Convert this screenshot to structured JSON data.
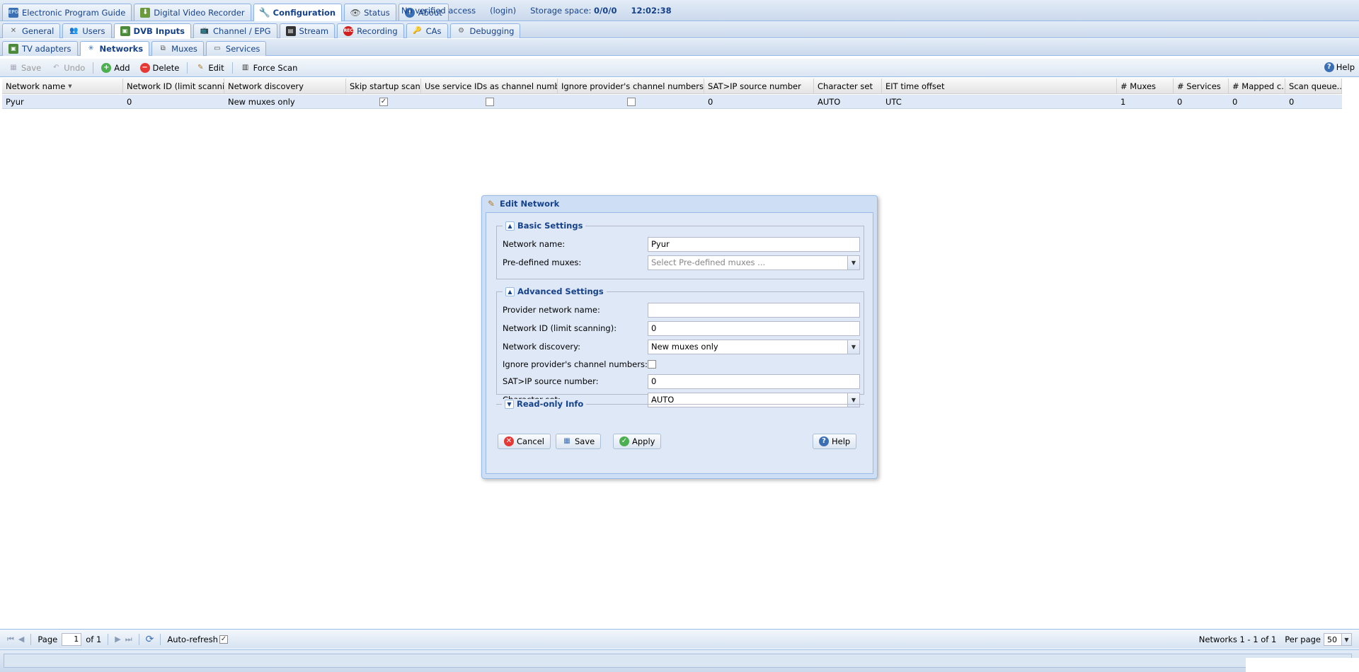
{
  "topbar": {
    "tabs": [
      {
        "label": "Electronic Program Guide",
        "icon": "epg-icon",
        "active": false
      },
      {
        "label": "Digital Video Recorder",
        "icon": "download-icon",
        "active": false
      },
      {
        "label": "Configuration",
        "icon": "wrench-icon",
        "active": true
      },
      {
        "label": "Status",
        "icon": "eye-icon",
        "active": false
      },
      {
        "label": "About",
        "icon": "info-icon",
        "active": false
      }
    ],
    "access": "No verified access",
    "login": "(login)",
    "storage_label": "Storage space:",
    "storage_value": "0/0/0",
    "time": "12:02:38"
  },
  "config_tabs": [
    {
      "label": "General",
      "icon": "tools-icon",
      "active": false
    },
    {
      "label": "Users",
      "icon": "users-icon",
      "active": false
    },
    {
      "label": "DVB Inputs",
      "icon": "tv-card-icon",
      "active": true
    },
    {
      "label": "Channel / EPG",
      "icon": "tv-icon",
      "active": false
    },
    {
      "label": "Stream",
      "icon": "film-icon",
      "active": false
    },
    {
      "label": "Recording",
      "icon": "rec-icon",
      "active": false
    },
    {
      "label": "CAs",
      "icon": "key-icon",
      "active": false
    },
    {
      "label": "Debugging",
      "icon": "bug-icon",
      "active": false
    }
  ],
  "dvb_tabs": [
    {
      "label": "TV adapters",
      "icon": "adapter-icon",
      "active": false
    },
    {
      "label": "Networks",
      "icon": "antenna-icon",
      "active": true
    },
    {
      "label": "Muxes",
      "icon": "muxes-icon",
      "active": false
    },
    {
      "label": "Services",
      "icon": "services-icon",
      "active": false
    }
  ],
  "toolbar": {
    "save": "Save",
    "undo": "Undo",
    "add": "Add",
    "delete": "Delete",
    "edit": "Edit",
    "force_scan": "Force Scan",
    "help": "Help"
  },
  "grid": {
    "columns": [
      "Network name",
      "Network ID (limit scanning)",
      "Network discovery",
      "Skip startup scan",
      "Use service IDs as channel numbers",
      "Ignore provider's channel numbers",
      "SAT>IP source number",
      "Character set",
      "EIT time offset",
      "# Muxes",
      "# Services",
      "# Mapped c...",
      "Scan queue..."
    ],
    "rows": [
      {
        "network_name": "Pyur",
        "network_id": "0",
        "discovery": "New muxes only",
        "skip_startup_scan": true,
        "use_service_ids": false,
        "ignore_provider": false,
        "satip_source": "0",
        "charset": "AUTO",
        "eit_offset": "UTC",
        "muxes": "1",
        "services": "0",
        "mapped": "0",
        "scan_queue": "0"
      }
    ]
  },
  "dialog": {
    "title": "Edit Network",
    "basic_legend": "Basic Settings",
    "network_name_label": "Network name:",
    "network_name_value": "Pyur",
    "predefined_label": "Pre-defined muxes:",
    "predefined_placeholder": "Select Pre-defined muxes ...",
    "advanced_legend": "Advanced Settings",
    "provider_label": "Provider network name:",
    "provider_value": "",
    "netid_label": "Network ID (limit scanning):",
    "netid_value": "0",
    "discovery_label": "Network discovery:",
    "discovery_value": "New muxes only",
    "ignore_label": "Ignore provider's channel numbers:",
    "ignore_checked": false,
    "satip_label": "SAT>IP source number:",
    "satip_value": "0",
    "charset_label": "Character set:",
    "charset_value": "AUTO",
    "readonly_legend": "Read-only Info",
    "cancel": "Cancel",
    "save": "Save",
    "apply": "Apply",
    "help": "Help"
  },
  "pager": {
    "page_label": "Page",
    "page_value": "1",
    "of_label": "of 1",
    "autorefresh_label": "Auto-refresh",
    "autorefresh_checked": true,
    "summary": "Networks 1 - 1 of 1",
    "perpage_label": "Per page",
    "perpage_value": "50"
  }
}
